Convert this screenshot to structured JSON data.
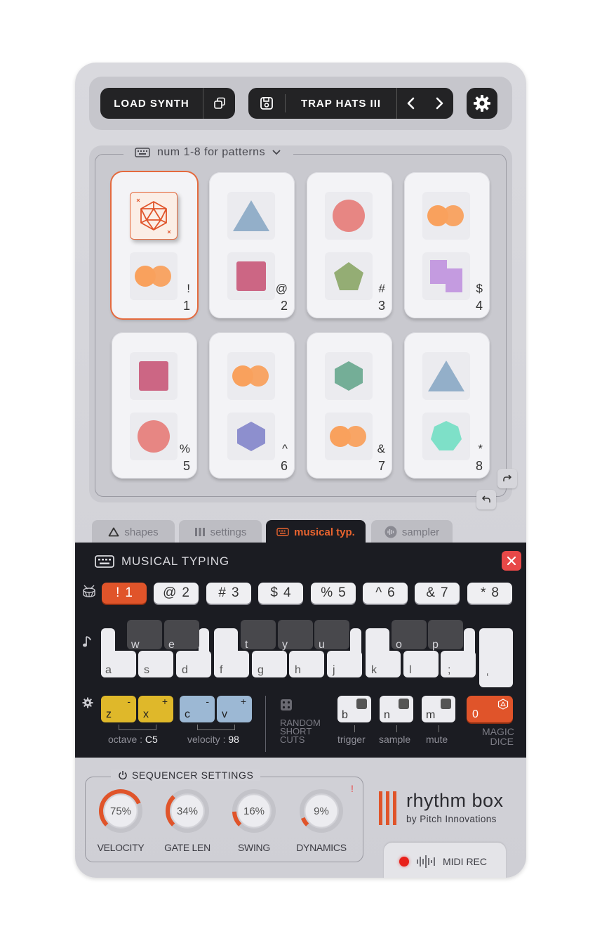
{
  "topbar": {
    "load_synth": "LOAD SYNTH",
    "preset_name": "TRAP HATS III"
  },
  "patterns": {
    "hint": "num 1-8 for patterns",
    "pads": [
      {
        "sym": "!",
        "num": "1",
        "top_shape": "dice-icon",
        "bottom_shape": "double-circle",
        "active": true
      },
      {
        "sym": "@",
        "num": "2",
        "top_shape": "triangle",
        "bottom_shape": "square"
      },
      {
        "sym": "#",
        "num": "3",
        "top_shape": "circle",
        "bottom_shape": "pentagon"
      },
      {
        "sym": "$",
        "num": "4",
        "top_shape": "double-circle",
        "bottom_shape": "l-block"
      },
      {
        "sym": "%",
        "num": "5",
        "top_shape": "square",
        "bottom_shape": "circle"
      },
      {
        "sym": "^",
        "num": "6",
        "top_shape": "double-circle",
        "bottom_shape": "hexagon"
      },
      {
        "sym": "&",
        "num": "7",
        "top_shape": "hexagon",
        "bottom_shape": "double-circle"
      },
      {
        "sym": "*",
        "num": "8",
        "top_shape": "triangle",
        "bottom_shape": "heptagon"
      }
    ]
  },
  "tabs": [
    {
      "label": "shapes",
      "active": false
    },
    {
      "label": "settings",
      "active": false
    },
    {
      "label": "musical typ.",
      "active": true
    },
    {
      "label": "sampler",
      "active": false
    }
  ],
  "musical_typing": {
    "title": "MUSICAL TYPING",
    "pattern_keys": [
      {
        "sym": "!",
        "num": "1",
        "active": true
      },
      {
        "sym": "@",
        "num": "2"
      },
      {
        "sym": "#",
        "num": "3"
      },
      {
        "sym": "$",
        "num": "4"
      },
      {
        "sym": "%",
        "num": "5"
      },
      {
        "sym": "^",
        "num": "6"
      },
      {
        "sym": "&",
        "num": "7"
      },
      {
        "sym": "*",
        "num": "8"
      }
    ],
    "white_keys": [
      "a",
      "s",
      "d",
      "f",
      "g",
      "h",
      "j",
      "k",
      "l",
      ";",
      "‘"
    ],
    "black_keys": [
      "w",
      "e",
      "t",
      "y",
      "u",
      "o",
      "p"
    ],
    "controls": {
      "z": "z",
      "x": "x",
      "c": "c",
      "v": "v",
      "minus": "-",
      "plus": "+",
      "octave_label": "octave :",
      "octave_value": "C5",
      "velocity_label": "velocity :",
      "velocity_value": "98",
      "random_shortcuts": [
        "RANDOM",
        "SHORT",
        "CUTS"
      ],
      "b": "b",
      "n": "n",
      "m": "m",
      "zero": "0",
      "trigger": "trigger",
      "sample": "sample",
      "mute": "mute",
      "magic_dice": [
        "MAGIC",
        "DICE"
      ]
    }
  },
  "sequencer": {
    "title": "SEQUENCER SETTINGS",
    "alert": "!",
    "knobs": [
      {
        "label": "VELOCITY",
        "value": "75%",
        "fraction": 0.75
      },
      {
        "label": "GATE LEN",
        "value": "34%",
        "fraction": 0.34
      },
      {
        "label": "SWING",
        "value": "16%",
        "fraction": 0.16
      },
      {
        "label": "DYNAMICS",
        "value": "9%",
        "fraction": 0.09
      }
    ]
  },
  "brand": {
    "name": "rhythm box",
    "sub": "by Pitch Innovations"
  },
  "midi_rec": "MIDI REC",
  "colors": {
    "accent": "#e0542a",
    "dark_panel": "#1b1c22",
    "control_yellow": "#dfb82a",
    "control_blue": "#9cb8d4",
    "rec_red": "#e8201a"
  }
}
